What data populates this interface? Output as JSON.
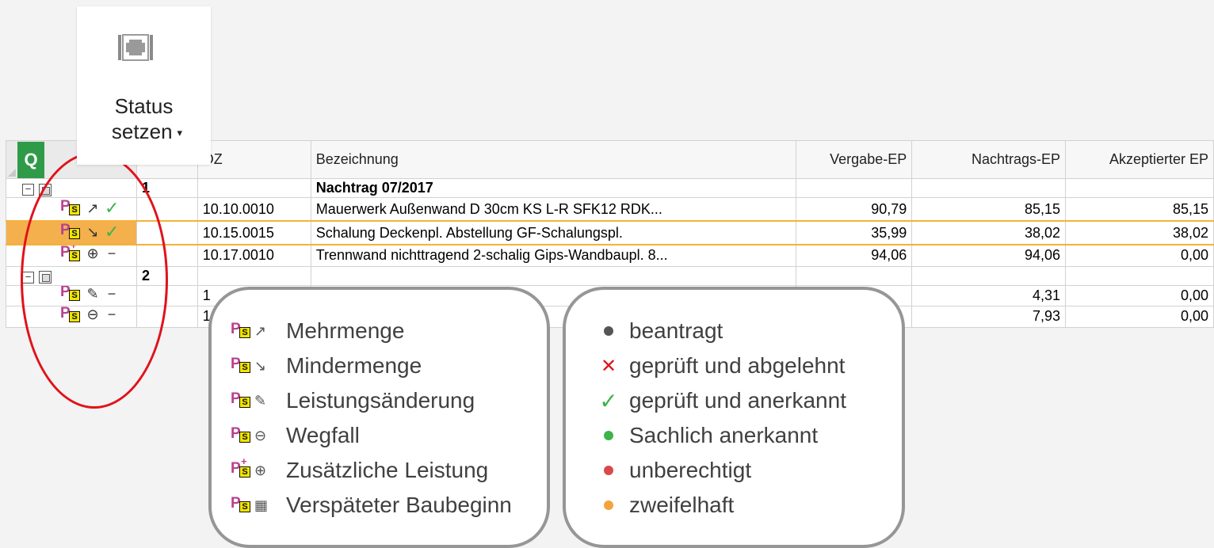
{
  "ribbon": {
    "label_line1": "Status",
    "label_line2": "setzen",
    "caret": "▾",
    "icon": "status-set-icon"
  },
  "grid": {
    "search_icon": "Q",
    "columns": [
      "",
      "",
      "OZ",
      "Bezeichnung",
      "Vergabe-EP",
      "Nachtrags-EP",
      "Akzeptierter EP"
    ],
    "rows": [
      {
        "type": "group",
        "nr": "1",
        "oz": "",
        "bez": "Nachtrag 07/2017",
        "vep": "",
        "nep": "",
        "aep": ""
      },
      {
        "type": "item",
        "arrow": "↗",
        "state": "✓",
        "oz": "10.10.0010",
        "bez": "Mauerwerk Außenwand D 30cm KS L-R SFK12 RDK...",
        "vep": "90,79",
        "nep": "85,15",
        "aep": "85,15"
      },
      {
        "type": "item",
        "arrow": "↘",
        "state": "✓",
        "oz": "10.15.0015",
        "bez": "Schalung Deckenpl. Abstellung GF-Schalungspl.",
        "vep": "35,99",
        "nep": "38,02",
        "aep": "38,02"
      },
      {
        "type": "item",
        "arrow": "⊕",
        "state": "−",
        "oz": "10.17.0010",
        "bez": "Trennwand nichttragend 2-schalig Gips-Wandbaupl. 8...",
        "vep": "94,06",
        "nep": "94,06",
        "aep": "0,00"
      },
      {
        "type": "group",
        "nr": "2",
        "oz": "",
        "bez": "",
        "vep": "",
        "nep": "",
        "aep": ""
      },
      {
        "type": "item",
        "arrow": "✎",
        "state": "−",
        "oz": "1",
        "bez": "",
        "vep": "",
        "nep": "4,31",
        "aep": "0,00"
      },
      {
        "type": "item",
        "arrow": "⊖",
        "state": "−",
        "oz": "1",
        "bez": "",
        "vep": "",
        "nep": "7,93",
        "aep": "0,00"
      }
    ]
  },
  "legend_left": {
    "items": [
      {
        "sym": "↗",
        "label": "Mehrmenge"
      },
      {
        "sym": "↘",
        "label": "Mindermenge"
      },
      {
        "sym": "✎",
        "label": "Leistungsänderung"
      },
      {
        "sym": "⊖",
        "label": "Wegfall"
      },
      {
        "sym": "⊕",
        "label": "Zusätzliche Leistung"
      },
      {
        "sym": "▦",
        "label": "Verspäteter Baubeginn"
      }
    ]
  },
  "legend_right": {
    "items": [
      {
        "sym": "dot",
        "color": "#555555",
        "label": "beantragt"
      },
      {
        "sym": "x",
        "color": "#e0121b",
        "label": "geprüft und abgelehnt"
      },
      {
        "sym": "check",
        "color": "#3db34a",
        "label": "geprüft und anerkannt"
      },
      {
        "sym": "dot",
        "color": "#3db34a",
        "label": "Sachlich anerkannt"
      },
      {
        "sym": "dot",
        "color": "#d9484a",
        "label": "unberechtigt"
      },
      {
        "sym": "dot",
        "color": "#f2a33a",
        "label": "zweifelhaft"
      }
    ]
  },
  "colors": {
    "highlight_ellipse": "#e0121b",
    "selected_row": "#f4b23a",
    "search_button": "#2f9b48"
  }
}
